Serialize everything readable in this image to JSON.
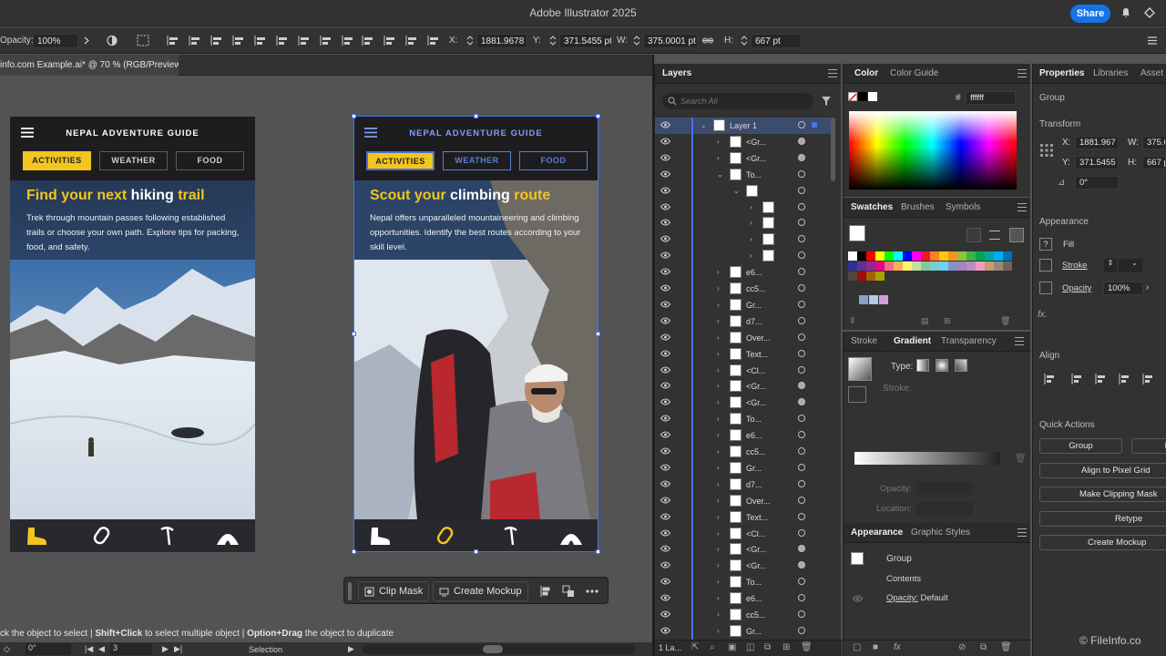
{
  "app": {
    "title": "Adobe Illustrator 2025",
    "share_label": "Share"
  },
  "controlbar": {
    "opacity_label": "Opacity:",
    "opacity_value": "100%",
    "x_label": "X:",
    "x_value": "1881.9678 p",
    "y_label": "Y:",
    "y_value": "371.5455 pt",
    "w_label": "W:",
    "w_value": "375.0001 pt",
    "h_label": "H:",
    "h_value": "667 pt"
  },
  "document": {
    "tab_label": "info.com Example.ai* @ 70 % (RGB/Preview)"
  },
  "artboard1": {
    "title": "NEPAL ADVENTURE GUIDE",
    "tabs": [
      "ACTIVITIES",
      "WEATHER",
      "FOOD"
    ],
    "heading_a": "Find your next ",
    "heading_b": "hiking",
    "heading_c": " trail",
    "body": "Trek through mountain passes following established trails or choose your own path. Explore tips for packing, food, and safety."
  },
  "artboard2": {
    "title": "NEPAL ADVENTURE GUIDE",
    "tabs": [
      "ACTIVITIES",
      "WEATHER",
      "FOOD"
    ],
    "heading_a": "Scout your ",
    "heading_b": "climbing",
    "heading_c": " route",
    "body": "Nepal offers unparalleled mountaineering and climbing opportunities. Identify the best routes according to your skill level."
  },
  "context_bar": {
    "clip_mask": "Clip Mask",
    "create_mockup": "Create Mockup"
  },
  "hint": {
    "a": "ck the object to select  |  ",
    "b": "Shift+Click",
    "c": " to select multiple object  |  ",
    "d": "Option+Drag",
    "e": " the object to duplicate"
  },
  "status": {
    "rotate": "0°",
    "artboard_num": "3",
    "tool": "Selection"
  },
  "layers": {
    "tab": "Layers",
    "search_placeholder": "Search All",
    "rows": [
      "Layer 1",
      "<Gr...",
      "<Gr...",
      "To...",
      "",
      "",
      "",
      "",
      "",
      "e6...",
      "cc5...",
      "Gr...",
      "d7...",
      "Over...",
      "Text...",
      "<Cl...",
      "<Gr...",
      "<Gr...",
      "To...",
      "e6...",
      "cc5...",
      "Gr...",
      "d7...",
      "Over...",
      "Text...",
      "<Cl...",
      "<Gr...",
      "<Gr...",
      "To...",
      "e6...",
      "cc5...",
      "Gr..."
    ],
    "footer": "1 La..."
  },
  "color_panel": {
    "tabs": [
      "Color",
      "Color Guide"
    ],
    "hex_label": "#",
    "hex_value": "ffffff"
  },
  "swatches_panel": {
    "tabs": [
      "Swatches",
      "Brushes",
      "Symbols"
    ]
  },
  "gradient_panel": {
    "tabs": [
      "Stroke",
      "Gradient",
      "Transparency"
    ],
    "type_label": "Type:",
    "stroke_label": "Stroke:",
    "opacity_label": "Opacity:",
    "location_label": "Location:"
  },
  "appearance_panel": {
    "tabs": [
      "Appearance",
      "Graphic Styles"
    ],
    "group_label": "Group",
    "contents_label": "Contents",
    "opacity_label": "Opacity:",
    "opacity_value": "Default"
  },
  "properties": {
    "tabs": [
      "Properties",
      "Libraries",
      "Asset"
    ],
    "object_type": "Group",
    "transform_label": "Transform",
    "x_label": "X:",
    "x_value": "1881.967",
    "y_label": "Y:",
    "y_value": "371.5455",
    "w_label": "W:",
    "w_value": "375.0",
    "h_label": "H:",
    "h_value": "667 pt",
    "rotate_value": "0°",
    "appearance_label": "Appearance",
    "fill_label": "Fill",
    "stroke_label": "Stroke",
    "opacity_label": "Opacity",
    "opacity_value": "100%",
    "fx_label": "fx.",
    "align_label": "Align",
    "quick_actions_label": "Quick Actions",
    "btn_group": "Group",
    "btn_r": "R",
    "btn_align_pixel": "Align to Pixel Grid",
    "btn_make_clip": "Make Clipping Mask",
    "btn_retype": "Retype",
    "btn_create_mockup": "Create Mockup"
  },
  "watermark": "© FileInfo.co",
  "colors": {
    "accent_yellow": "#f2c51f",
    "selection_blue": "#4a73e8",
    "share_blue": "#1473e6",
    "hero_navy": "#263a57"
  }
}
